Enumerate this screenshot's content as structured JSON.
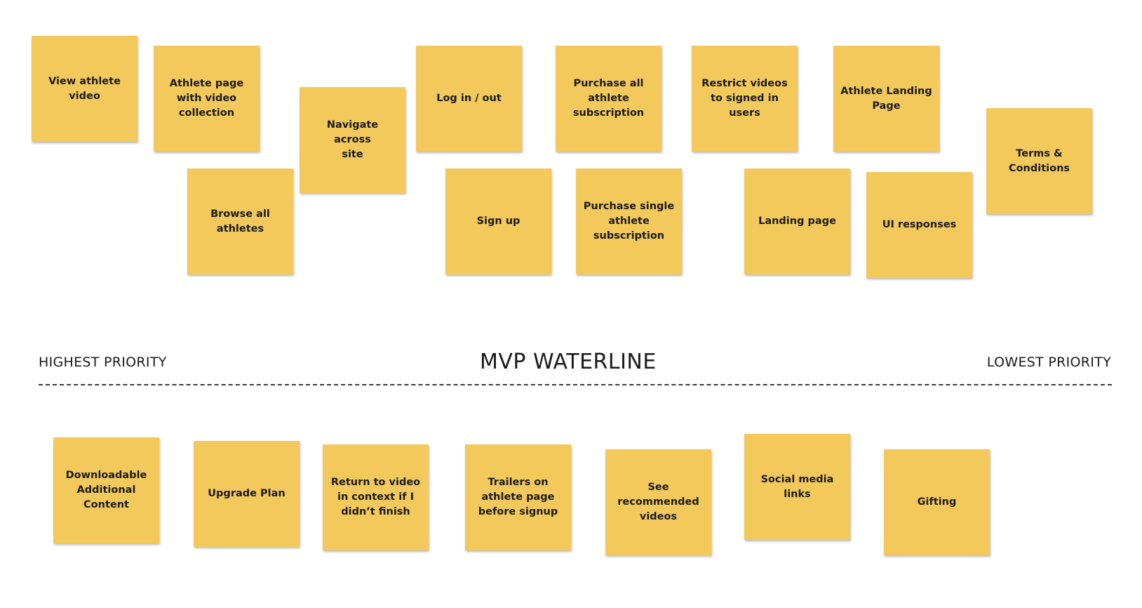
{
  "board": {
    "note_color": "#f3c95c",
    "above_waterline": [
      {
        "id": "view-athlete-video",
        "text": "View athlete\nvideo"
      },
      {
        "id": "athlete-page-video-collection",
        "text": "Athlete page\nwith video\ncollection"
      },
      {
        "id": "browse-all-athletes",
        "text": "Browse all\nathletes"
      },
      {
        "id": "navigate-across-site",
        "text": "Navigate\nacross\nsite"
      },
      {
        "id": "log-in-out",
        "text": "Log in / out"
      },
      {
        "id": "sign-up",
        "text": "Sign up"
      },
      {
        "id": "purchase-all-athlete-subscription",
        "text": "Purchase all\nathlete\nsubscription"
      },
      {
        "id": "purchase-single-athlete-subscription",
        "text": "Purchase single\nathlete\nsubscription"
      },
      {
        "id": "restrict-videos",
        "text": "Restrict videos\nto signed in\nusers"
      },
      {
        "id": "landing-page",
        "text": "Landing page"
      },
      {
        "id": "athlete-landing-page",
        "text": "Athlete Landing\nPage"
      },
      {
        "id": "ui-responses",
        "text": "UI responses"
      },
      {
        "id": "terms-conditions",
        "text": "Terms &\nConditions"
      }
    ],
    "below_waterline": [
      {
        "id": "downloadable-additional-content",
        "text": "Downloadable\nAdditional\nContent"
      },
      {
        "id": "upgrade-plan",
        "text": "Upgrade Plan"
      },
      {
        "id": "return-to-video",
        "text": "Return to video\nin context if I\ndidn’t finish"
      },
      {
        "id": "trailers-on-athlete-page",
        "text": "Trailers on\nathlete page\nbefore signup"
      },
      {
        "id": "see-recommended-videos",
        "text": "See recommended\nvideos"
      },
      {
        "id": "social-media-links",
        "text": "Social media\nlinks"
      },
      {
        "id": "gifting",
        "text": "Gifting"
      }
    ]
  },
  "waterline": {
    "left_label": "HIGHEST PRIORITY",
    "center_label": "MVP WATERLINE",
    "right_label": "LOWEST PRIORITY"
  }
}
